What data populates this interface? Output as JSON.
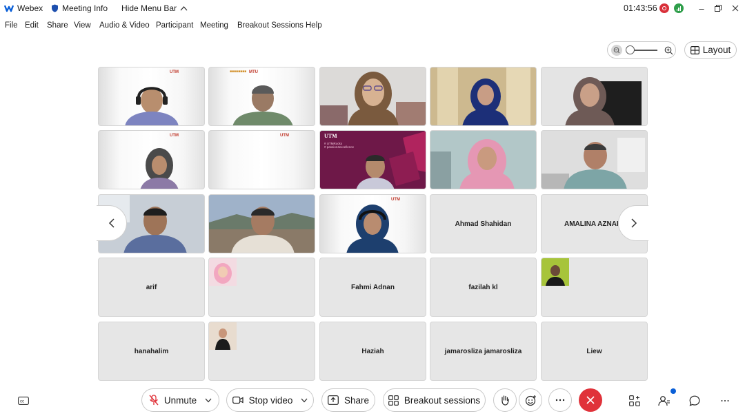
{
  "titlebar": {
    "app_name": "Webex",
    "meeting_info": "Meeting Info",
    "hide_menu": "Hide Menu Bar",
    "timer": "01:43:56"
  },
  "menu": [
    "File",
    "Edit",
    "Share",
    "View",
    "Audio & Video",
    "Participant",
    "Meeting",
    "Breakout Sessions",
    "Help"
  ],
  "view": {
    "layout_label": "Layout"
  },
  "participants": [
    "Ahmad Shahidan",
    "AMALINA AZNAI",
    "arif",
    "Fahmi Adnan",
    "fazilah kl",
    "hanahalim",
    "Haziah",
    "jamarosliza jamarosliza",
    "Liew"
  ],
  "tile_badges": {
    "utm": "UTM",
    "utm_slide_1": "# UTMRocks",
    "utm_slide_2": "# passion4excellence",
    "mtu": "MTU"
  },
  "toolbar": {
    "unmute": "Unmute",
    "stop_video": "Stop video",
    "share": "Share",
    "breakout": "Breakout sessions"
  },
  "colors": {
    "accent_red": "#e0323a",
    "brand_blue": "#0a5fd7",
    "recording": "#d9303a",
    "network": "#2e9e4a"
  }
}
